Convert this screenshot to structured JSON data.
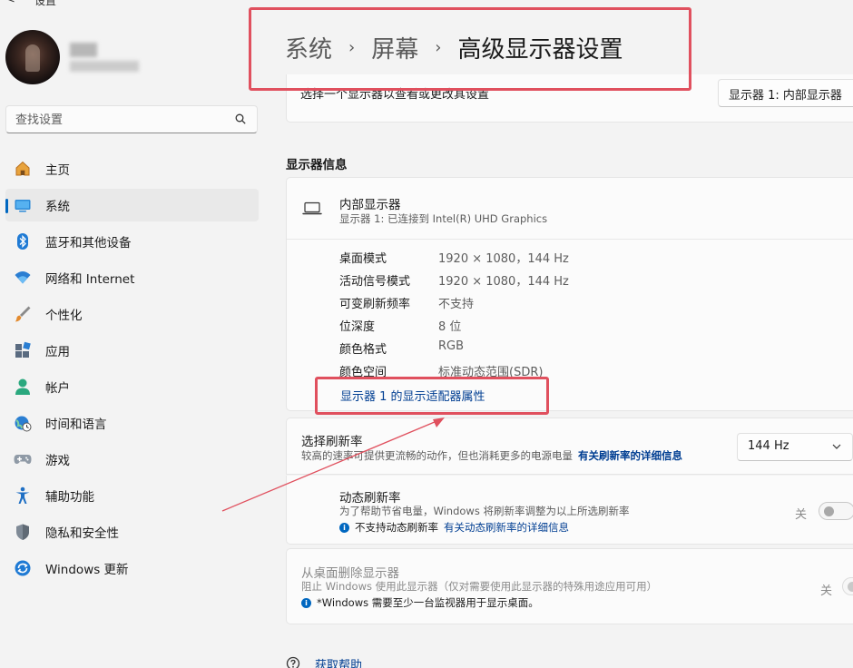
{
  "window": {
    "title": "设置",
    "back_glyph": "<"
  },
  "search": {
    "placeholder": "查找设置"
  },
  "colors": {
    "accent": "#0067c0",
    "link": "#003e92",
    "annotation": "#e0505e"
  },
  "nav": {
    "items": [
      {
        "label": "主页",
        "icon": "home-icon",
        "active": false
      },
      {
        "label": "系统",
        "icon": "display-icon",
        "active": true
      },
      {
        "label": "蓝牙和其他设备",
        "icon": "bluetooth-icon",
        "active": false
      },
      {
        "label": "网络和 Internet",
        "icon": "wifi-icon",
        "active": false
      },
      {
        "label": "个性化",
        "icon": "brush-icon",
        "active": false
      },
      {
        "label": "应用",
        "icon": "apps-icon",
        "active": false
      },
      {
        "label": "帐户",
        "icon": "account-icon",
        "active": false
      },
      {
        "label": "时间和语言",
        "icon": "globe-clock-icon",
        "active": false
      },
      {
        "label": "游戏",
        "icon": "gamepad-icon",
        "active": false
      },
      {
        "label": "辅助功能",
        "icon": "accessibility-icon",
        "active": false
      },
      {
        "label": "隐私和安全性",
        "icon": "shield-icon",
        "active": false
      },
      {
        "label": "Windows 更新",
        "icon": "update-icon",
        "active": false
      }
    ]
  },
  "breadcrumb": {
    "parent1": "系统",
    "parent2": "屏幕",
    "current": "高级显示器设置",
    "separator": "›"
  },
  "select_display": {
    "label": "选择一个显示器以查看或更改其设置",
    "dropdown_value": "显示器 1: 内部显示器"
  },
  "display_info": {
    "section_title": "显示器信息",
    "name": "内部显示器",
    "subtitle": "显示器 1: 已连接到 Intel(R) UHD Graphics",
    "specs": [
      {
        "label": "桌面模式",
        "value": "1920 × 1080，144 Hz"
      },
      {
        "label": "活动信号模式",
        "value": "1920 × 1080，144 Hz"
      },
      {
        "label": "可变刷新频率",
        "value": "不支持"
      },
      {
        "label": "位深度",
        "value": "8 位"
      },
      {
        "label": "颜色格式",
        "value": "RGB"
      },
      {
        "label": "颜色空间",
        "value": "标准动态范围(SDR)"
      }
    ],
    "adapter_link": "显示器 1 的显示适配器属性"
  },
  "refresh": {
    "title": "选择刷新率",
    "desc": "较高的速率可提供更流畅的动作，但也消耗更多的电源电量",
    "link": "有关刷新率的详细信息",
    "value": "144 Hz"
  },
  "dynamic_refresh": {
    "title": "动态刷新率",
    "desc": "为了帮助节省电量，Windows 将刷新率调整为以上所选刷新率",
    "note": "不支持动态刷新率",
    "note_link": "有关动态刷新率的详细信息",
    "toggle_label": "关"
  },
  "remove_display": {
    "title": "从桌面删除显示器",
    "desc": "阻止 Windows 使用此显示器（仅对需要使用此显示器的特殊用途应用可用）",
    "note": "*Windows 需要至少一台监视器用于显示桌面。",
    "toggle_label": "关"
  },
  "help": {
    "label": "获取帮助"
  }
}
